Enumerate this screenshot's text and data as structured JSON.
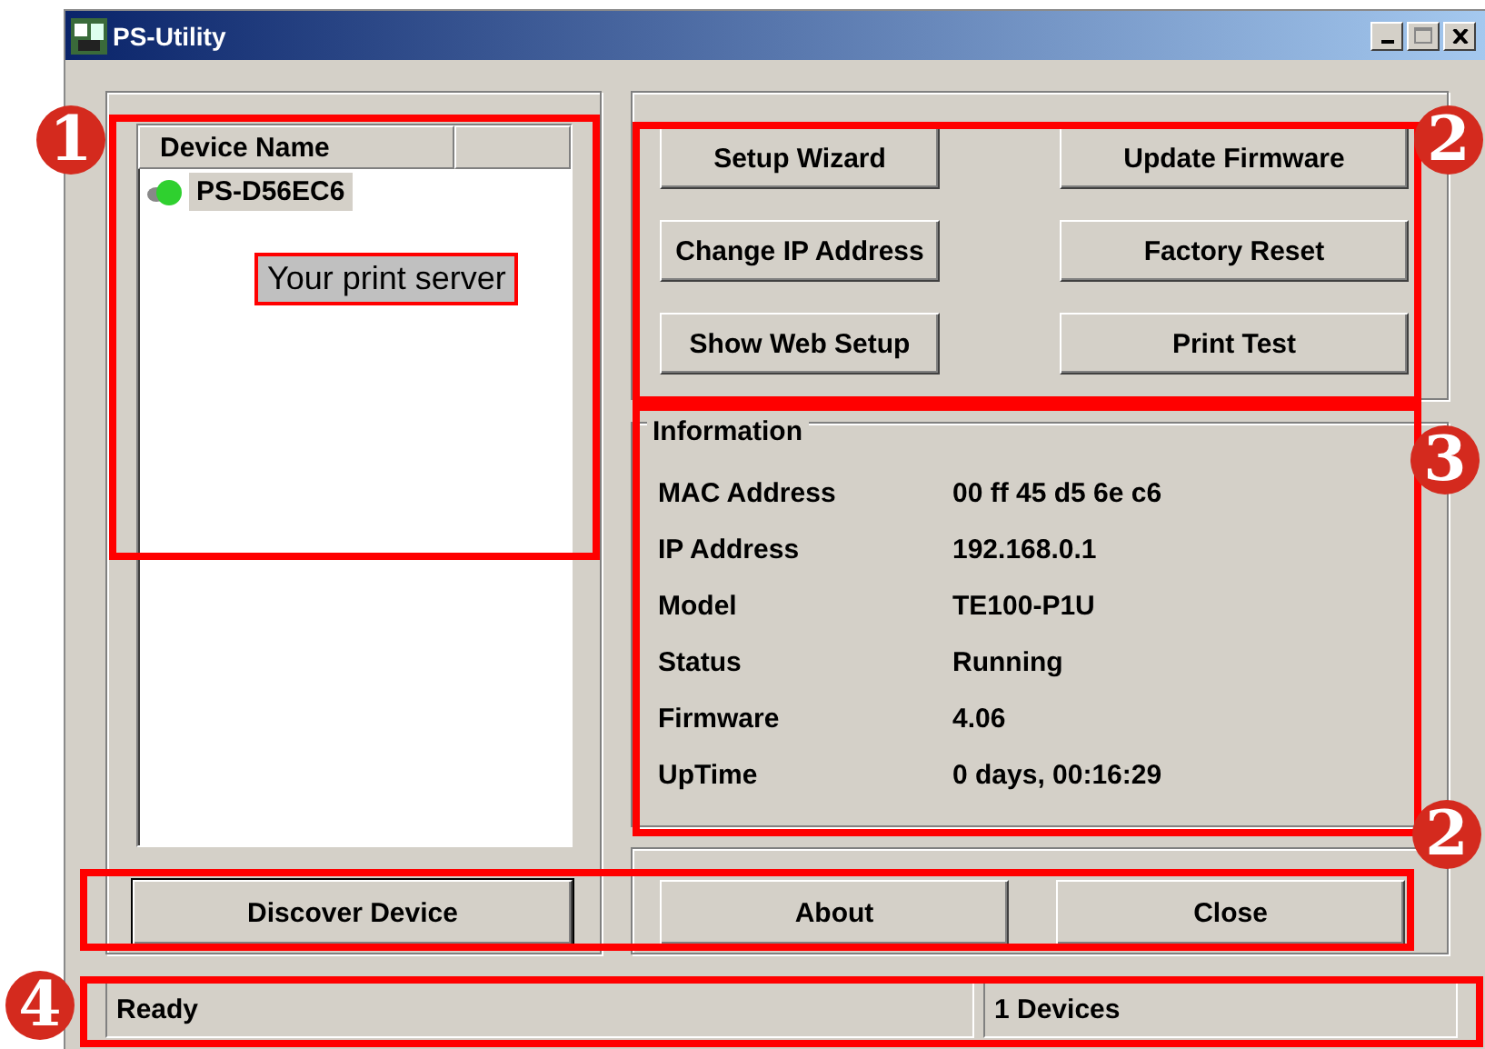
{
  "window": {
    "title": "PS-Utility"
  },
  "device_list": {
    "column": "Device Name",
    "items": [
      {
        "name": "PS-D56EC6",
        "selected": true
      }
    ]
  },
  "callout": "Your print server",
  "actions": [
    "Setup Wizard",
    "Update Firmware",
    "Change IP Address",
    "Factory Reset",
    "Show Web Setup",
    "Print Test"
  ],
  "information": {
    "title": "Information",
    "rows": [
      {
        "label": "MAC Address",
        "value": "00 ff 45 d5 6e c6"
      },
      {
        "label": "IP Address",
        "value": "192.168.0.1"
      },
      {
        "label": "Model",
        "value": "TE100-P1U"
      },
      {
        "label": "Status",
        "value": "Running"
      },
      {
        "label": "Firmware",
        "value": "4.06"
      },
      {
        "label": "UpTime",
        "value": "0 days, 00:16:29"
      }
    ]
  },
  "discover_button": "Discover Device",
  "bottom_buttons": [
    "About",
    "Close"
  ],
  "status_bar": [
    "Ready",
    "1 Devices"
  ],
  "markers": [
    "1",
    "2",
    "3",
    "2",
    "4"
  ]
}
